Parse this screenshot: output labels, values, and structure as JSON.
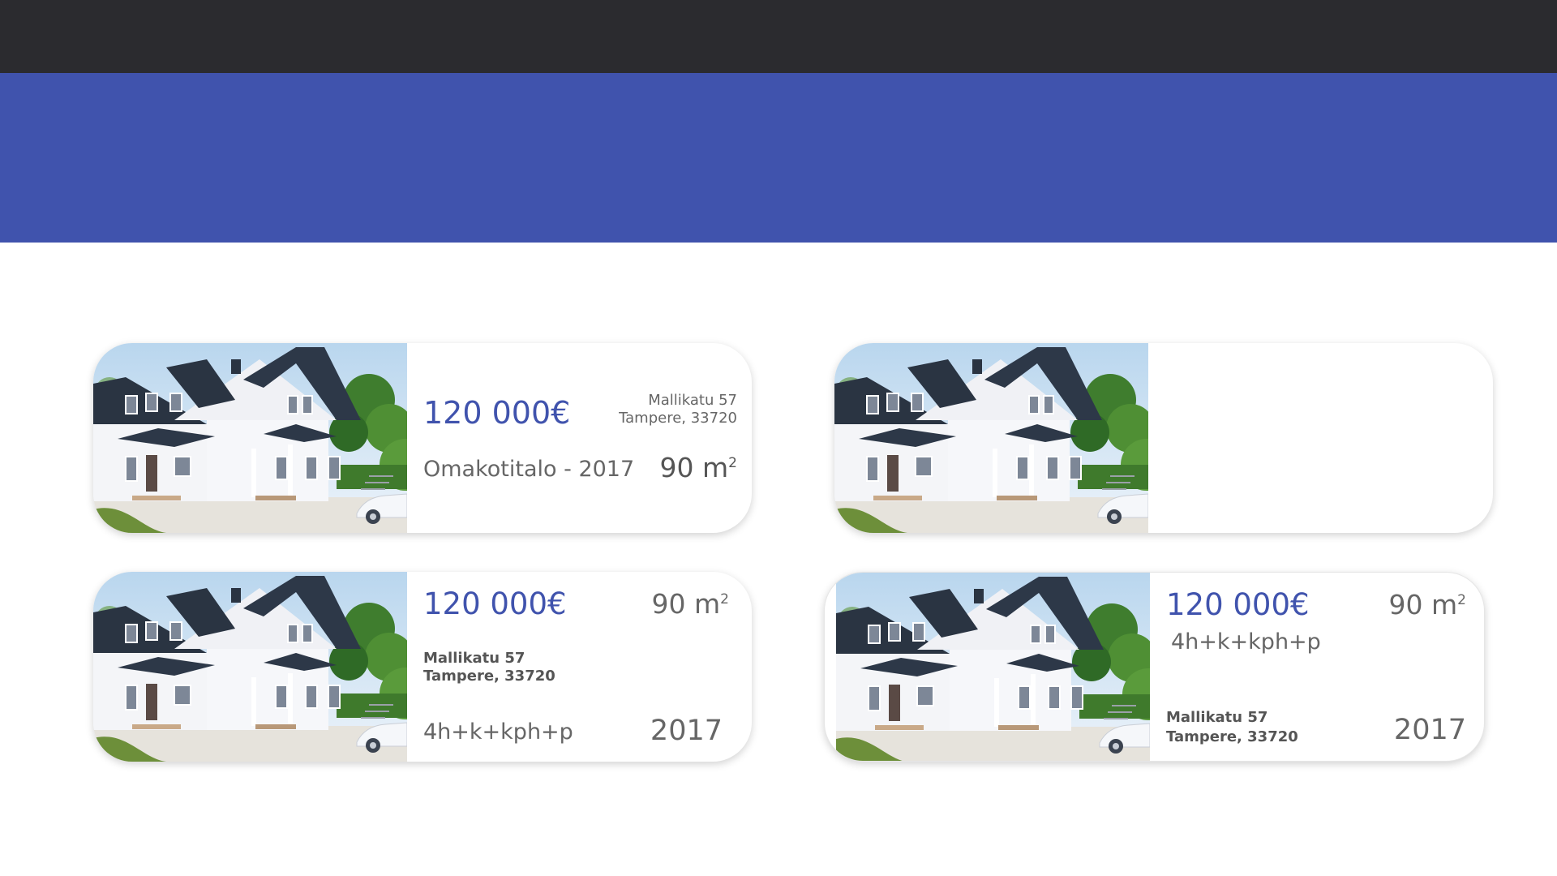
{
  "colors": {
    "topbar": "#2b2b2f",
    "hero": "#4053ad",
    "price": "#4053ad",
    "text": "#666666"
  },
  "listings": [
    {
      "price": "120 000€",
      "street": "Mallikatu 57",
      "city": "Tampere, 33720",
      "type_year": "Omakotitalo - 2017",
      "area_value": "90 m",
      "area_sup": "2"
    },
    {},
    {
      "price": "120 000€",
      "area_value": "90 m",
      "area_sup": "2",
      "street": "Mallikatu 57",
      "city": "Tampere, 33720",
      "rooms": "4h+k+kph+p",
      "year": "2017"
    },
    {
      "price": "120 000€",
      "area_value": "90 m",
      "area_sup": "2",
      "rooms": "4h+k+kph+p",
      "street": "Mallikatu 57",
      "city": "Tampere, 33720",
      "year": "2017"
    }
  ]
}
